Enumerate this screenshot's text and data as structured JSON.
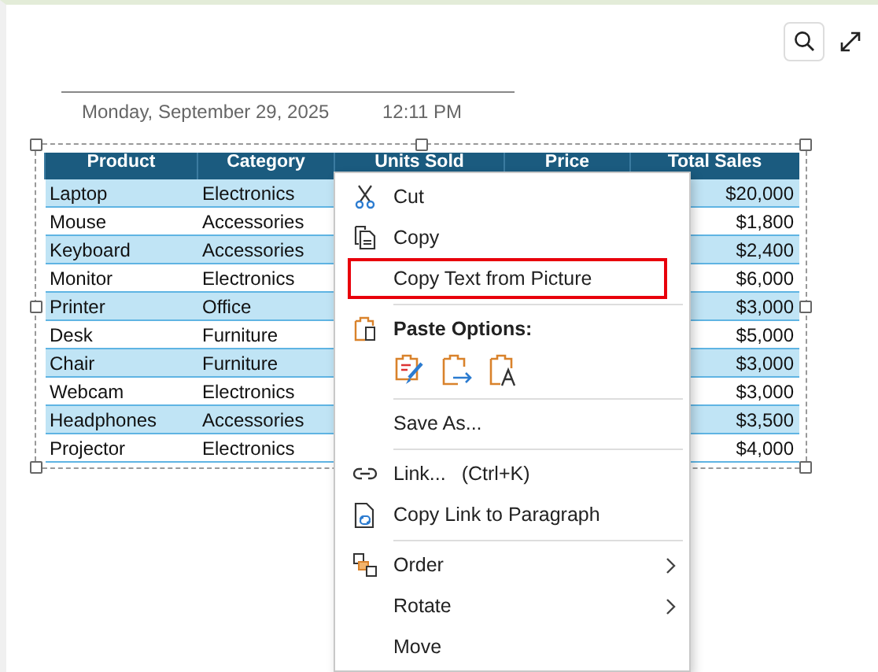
{
  "date_header": {
    "date": "Monday, September 29, 2025",
    "time": "12:11 PM"
  },
  "toolbar": {
    "buttons": [
      {
        "kind": "search"
      },
      {
        "kind": "expand"
      }
    ]
  },
  "table": {
    "columns": [
      "Product",
      "Category",
      "Units Sold",
      "Price",
      "Total Sales"
    ],
    "rows": [
      {
        "product": "Laptop",
        "category": "Electronics",
        "total_sales": "$20,000"
      },
      {
        "product": "Mouse",
        "category": "Accessories",
        "total_sales": "$1,800"
      },
      {
        "product": "Keyboard",
        "category": "Accessories",
        "total_sales": "$2,400"
      },
      {
        "product": "Monitor",
        "category": "Electronics",
        "total_sales": "$6,000"
      },
      {
        "product": "Printer",
        "category": "Office",
        "total_sales": "$3,000"
      },
      {
        "product": "Desk",
        "category": "Furniture",
        "total_sales": "$5,000"
      },
      {
        "product": "Chair",
        "category": "Furniture",
        "total_sales": "$3,000"
      },
      {
        "product": "Webcam",
        "category": "Electronics",
        "total_sales": "$3,000"
      },
      {
        "product": "Headphones",
        "category": "Accessories",
        "total_sales": "$3,500"
      },
      {
        "product": "Projector",
        "category": "Electronics",
        "total_sales": "$4,000"
      }
    ]
  },
  "context_menu": {
    "items": [
      {
        "kind": "item",
        "label": "Cut",
        "highlighted": false,
        "submenu": false
      },
      {
        "kind": "item",
        "label": "Copy",
        "highlighted": false,
        "submenu": false
      },
      {
        "kind": "item",
        "label": "Copy Text from Picture",
        "highlighted": true,
        "submenu": false
      },
      {
        "kind": "separator"
      },
      {
        "kind": "heading",
        "label": "Paste Options:"
      },
      {
        "kind": "paste-icons"
      },
      {
        "kind": "separator"
      },
      {
        "kind": "item",
        "label": "Save As...",
        "highlighted": false,
        "submenu": false
      },
      {
        "kind": "separator"
      },
      {
        "kind": "item",
        "label": "Link...",
        "shortcut": "(Ctrl+K)",
        "highlighted": false,
        "submenu": false
      },
      {
        "kind": "item",
        "label": "Copy Link to Paragraph",
        "highlighted": false,
        "submenu": false
      },
      {
        "kind": "separator"
      },
      {
        "kind": "item",
        "label": "Order",
        "highlighted": false,
        "submenu": true
      },
      {
        "kind": "item",
        "label": "Rotate",
        "highlighted": false,
        "submenu": true
      },
      {
        "kind": "item",
        "label": "Move",
        "highlighted": false,
        "submenu": false
      }
    ]
  }
}
